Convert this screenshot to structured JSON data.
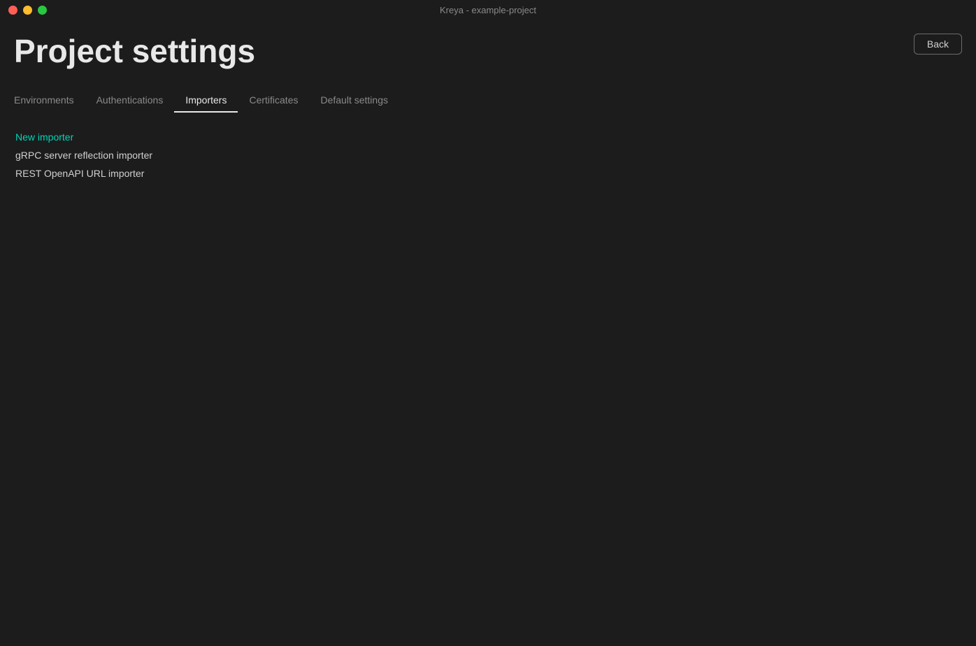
{
  "titlebar": {
    "title": "Kreya - example-project",
    "buttons": {
      "close": "close",
      "minimize": "minimize",
      "maximize": "maximize"
    }
  },
  "header": {
    "page_title": "Project settings",
    "back_button_label": "Back"
  },
  "tabs": [
    {
      "id": "environments",
      "label": "Environments",
      "active": false
    },
    {
      "id": "authentications",
      "label": "Authentications",
      "active": false
    },
    {
      "id": "importers",
      "label": "Importers",
      "active": true
    },
    {
      "id": "certificates",
      "label": "Certificates",
      "active": false
    },
    {
      "id": "default-settings",
      "label": "Default settings",
      "active": false
    }
  ],
  "importers": {
    "new_importer_label": "New importer",
    "items": [
      {
        "id": "grpc",
        "label": "gRPC server reflection importer"
      },
      {
        "id": "rest",
        "label": "REST OpenAPI URL importer"
      }
    ]
  }
}
